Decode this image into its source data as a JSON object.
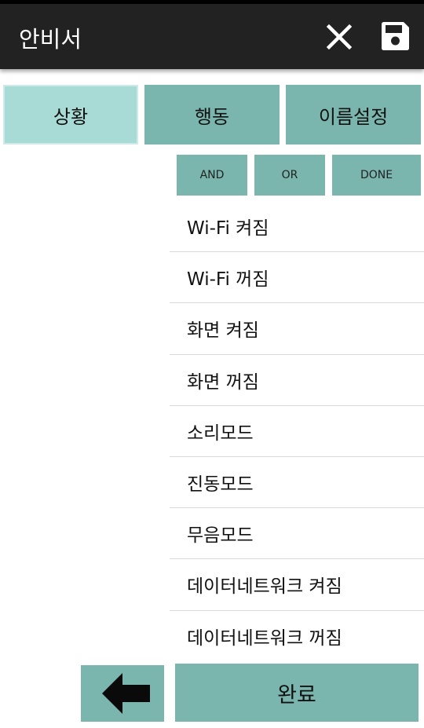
{
  "appbar": {
    "title": "안비서",
    "close_icon": "close-icon",
    "save_icon": "save-icon"
  },
  "tabs": [
    {
      "label": "상황",
      "active": true
    },
    {
      "label": "행동",
      "active": false
    },
    {
      "label": "이름설정",
      "active": false
    }
  ],
  "operators": [
    {
      "label": "AND"
    },
    {
      "label": "OR"
    },
    {
      "label": "DONE"
    }
  ],
  "conditions": [
    "Wi-Fi 켜짐",
    "Wi-Fi 꺼짐",
    "화면 켜짐",
    "화면 꺼짐",
    "소리모드",
    "진동모드",
    "무음모드",
    "데이터네트워크 켜짐",
    "데이터네트워크 꺼짐"
  ],
  "footer": {
    "back_icon": "arrow-left-icon",
    "done_label": "완료"
  },
  "colors": {
    "appbar": "#222222",
    "tab_active": "#a9dbd6",
    "accent": "#7ab6ae"
  }
}
